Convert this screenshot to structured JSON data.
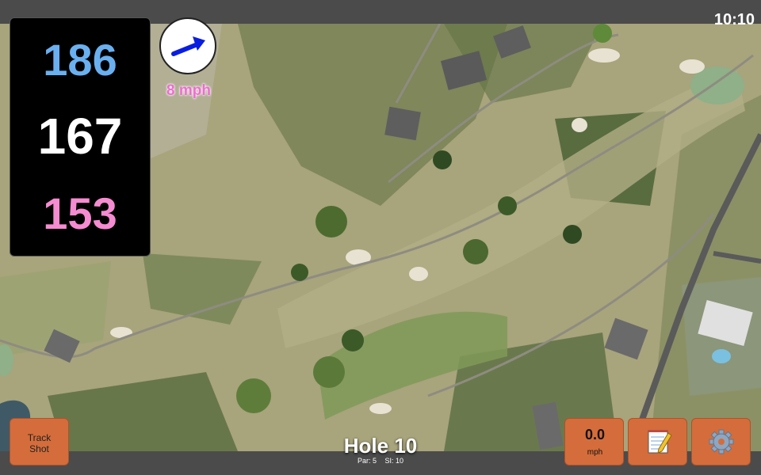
{
  "status": {
    "time": "10:10"
  },
  "distances": {
    "back": "186",
    "middle": "167",
    "front": "153"
  },
  "wind": {
    "speed": "8 mph",
    "direction_icon": "arrow-up-right-icon"
  },
  "hole": {
    "title": "Hole 10",
    "par": "Par: 5",
    "stroke_index": "SI: 10"
  },
  "buttons": {
    "track_shot_line1": "Track",
    "track_shot_line2": "Shot",
    "speed_value": "0.0",
    "speed_unit": "mph",
    "notes_icon": "notepad-icon",
    "settings_icon": "gear-icon"
  },
  "colors": {
    "back": "#6ab0f0",
    "middle": "#ffffff",
    "front": "#f58bd0",
    "accent": "#d46d3b",
    "wind": "#f06cd2"
  }
}
